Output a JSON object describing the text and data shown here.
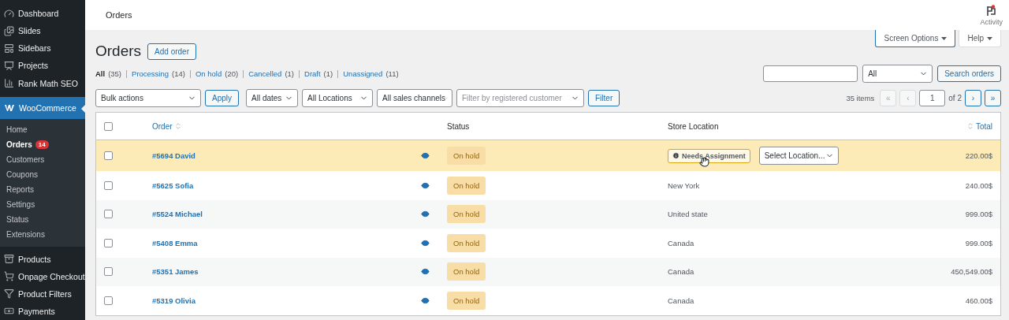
{
  "top_bar": {
    "title": "Orders",
    "activity": {
      "label": "Activity",
      "notification": true
    }
  },
  "sidebar": {
    "items": [
      {
        "label": "Dashboard",
        "selected": false
      },
      {
        "label": "Slides",
        "selected": false
      },
      {
        "label": "Sidebars",
        "selected": false
      },
      {
        "label": "Projects",
        "selected": false
      },
      {
        "label": "Rank Math SEO",
        "selected": false
      },
      {
        "label": "WooCommerce",
        "selected": true,
        "children": [
          {
            "label": "Home",
            "selected": false
          },
          {
            "label": "Orders",
            "selected": true,
            "badge": "14"
          },
          {
            "label": "Customers",
            "selected": false
          },
          {
            "label": "Coupons",
            "selected": false
          },
          {
            "label": "Reports",
            "selected": false
          },
          {
            "label": "Settings",
            "selected": false
          },
          {
            "label": "Status",
            "selected": false
          },
          {
            "label": "Extensions",
            "selected": false
          }
        ]
      },
      {
        "label": "Products",
        "selected": false
      },
      {
        "label": "Onpage Checkout",
        "selected": false
      },
      {
        "label": "Product Filters",
        "selected": false
      },
      {
        "label": "Payments",
        "selected": false
      }
    ]
  },
  "screen_tabs": [
    {
      "label": "Screen Options",
      "selected": true
    },
    {
      "label": "Help",
      "selected": false
    }
  ],
  "page": {
    "title": "Orders",
    "add_button": "Add order"
  },
  "status_filters": [
    {
      "label": "All",
      "count": "(35)",
      "selected": true
    },
    {
      "label": "Processing",
      "count": "(14)",
      "selected": false
    },
    {
      "label": "On hold",
      "count": "(20)",
      "selected": false
    },
    {
      "label": "Cancelled",
      "count": "(1)",
      "selected": false
    },
    {
      "label": "Draft",
      "count": "(1)",
      "selected": false
    },
    {
      "label": "Unassigned",
      "count": "(11)",
      "selected": false
    }
  ],
  "search": {
    "type_select": "All",
    "button": "Search orders"
  },
  "filters": {
    "bulk_actions": "Bulk actions",
    "apply": "Apply",
    "dates": "All dates",
    "locations": "All Locations",
    "channels": "All sales channels",
    "customer_placeholder": "Filter by registered customer",
    "filter_button": "Filter"
  },
  "pagination": {
    "items": "35 items",
    "buttons": [
      {
        "label": "«",
        "disabled": true
      },
      {
        "label": "‹",
        "disabled": true
      }
    ],
    "page": "1",
    "of": "of 2",
    "next_buttons": [
      {
        "label": "›",
        "disabled": false
      },
      {
        "label": "»",
        "disabled": false
      }
    ]
  },
  "table": {
    "select_all_checked": false,
    "order_column": "Order",
    "status_column": "Status",
    "location_column": "Store Location",
    "total_column": "Total",
    "rows": [
      {
        "order": "#5694 David",
        "status": "On hold",
        "location": {
          "kind": "assign",
          "badge": "Needs Assignment",
          "select": "Select Location..."
        },
        "total": "220.00$",
        "highlighted": true,
        "checked": false
      },
      {
        "order": "#5625 Sofia",
        "status": "On hold",
        "location": {
          "kind": "text",
          "text": "New York"
        },
        "total": "240.00$",
        "highlighted": false,
        "checked": false
      },
      {
        "order": "#5524 Michael",
        "status": "On hold",
        "location": {
          "kind": "text",
          "text": "United state"
        },
        "total": "999.00$",
        "highlighted": false,
        "checked": false
      },
      {
        "order": "#5408 Emma",
        "status": "On hold",
        "location": {
          "kind": "text",
          "text": "Canada"
        },
        "total": "999.00$",
        "highlighted": false,
        "checked": false
      },
      {
        "order": "#5351 James",
        "status": "On hold",
        "location": {
          "kind": "text",
          "text": "Canada"
        },
        "total": "450,549.00$",
        "highlighted": false,
        "checked": false
      },
      {
        "order": "#5319 Olivia",
        "status": "On hold",
        "location": {
          "kind": "text",
          "text": "Canada"
        },
        "total": "460.00$",
        "highlighted": false,
        "checked": false
      }
    ]
  }
}
